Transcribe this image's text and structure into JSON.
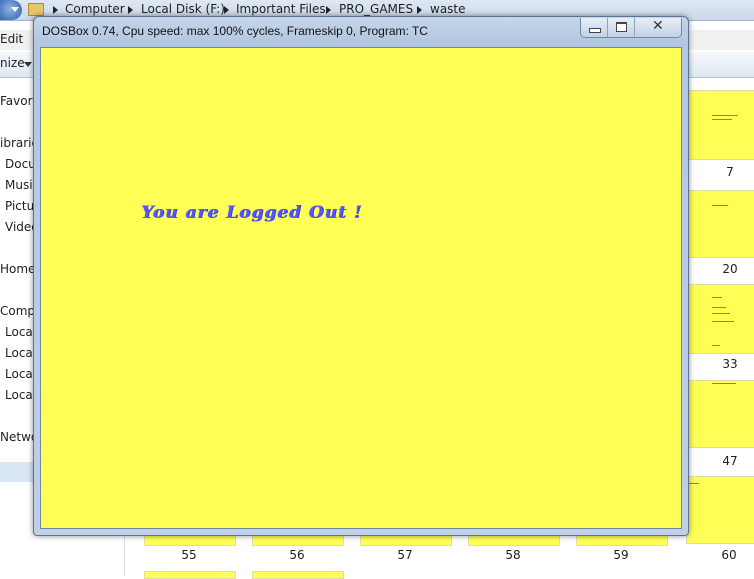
{
  "explorer": {
    "breadcrumbs": [
      "Computer",
      "Local Disk (F:)",
      "Important Files",
      "PRO_GAMES",
      "waste"
    ],
    "menu_edit": "Edit",
    "organize_label": "nize",
    "nav_items": [
      "Favorite",
      "ibrarie",
      "Docu",
      "Music",
      "Pictu",
      "Video",
      "Homeg",
      "Compu",
      "Local",
      "Local",
      "Local",
      "Local",
      "Netwo"
    ],
    "thumb_numbers": [
      "7",
      "20",
      "33",
      "47",
      "55",
      "56",
      "57",
      "58",
      "59",
      "60"
    ]
  },
  "dosbox": {
    "title": "DOSBox 0.74, Cpu speed: max 100% cycles, Frameskip  0, Program:     TC",
    "close_symbol": "✕",
    "screen_message": "You are Logged Out !",
    "screen_bg": "#ffff55",
    "text_color": "#5555ff"
  }
}
